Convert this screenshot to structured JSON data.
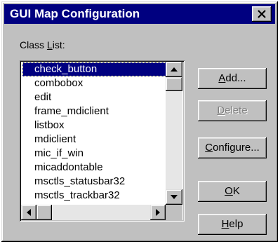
{
  "window": {
    "title": "GUI Map Configuration"
  },
  "class_list": {
    "label_prefix": "Class ",
    "label_mnemonic": "L",
    "label_suffix": "ist:",
    "selected_index": 0,
    "items": [
      "check_button",
      "combobox",
      "edit",
      "frame_mdiclient",
      "listbox",
      "mdiclient",
      "mic_if_win",
      "micaddontable",
      "msctls_statusbar32",
      "msctls_trackbar32"
    ]
  },
  "buttons": {
    "add": {
      "mnemonic": "A",
      "rest": "dd...",
      "enabled": true
    },
    "delete": {
      "mnemonic": "D",
      "rest": "elete",
      "enabled": false
    },
    "configure": {
      "mnemonic": "C",
      "rest": "onfigure...",
      "enabled": true
    },
    "ok": {
      "mnemonic": "O",
      "rest": "K",
      "enabled": true
    },
    "help": {
      "mnemonic": "H",
      "rest": "elp",
      "enabled": true
    }
  },
  "icons": {
    "close": "close-icon",
    "scroll_up": "arrow-up-icon",
    "scroll_down": "arrow-down-icon",
    "scroll_left": "arrow-left-icon",
    "scroll_right": "arrow-right-icon"
  },
  "colors": {
    "titlebar": "#000080",
    "face": "#c0c0c0",
    "selection": "#000080",
    "disabled_text": "#808080"
  }
}
